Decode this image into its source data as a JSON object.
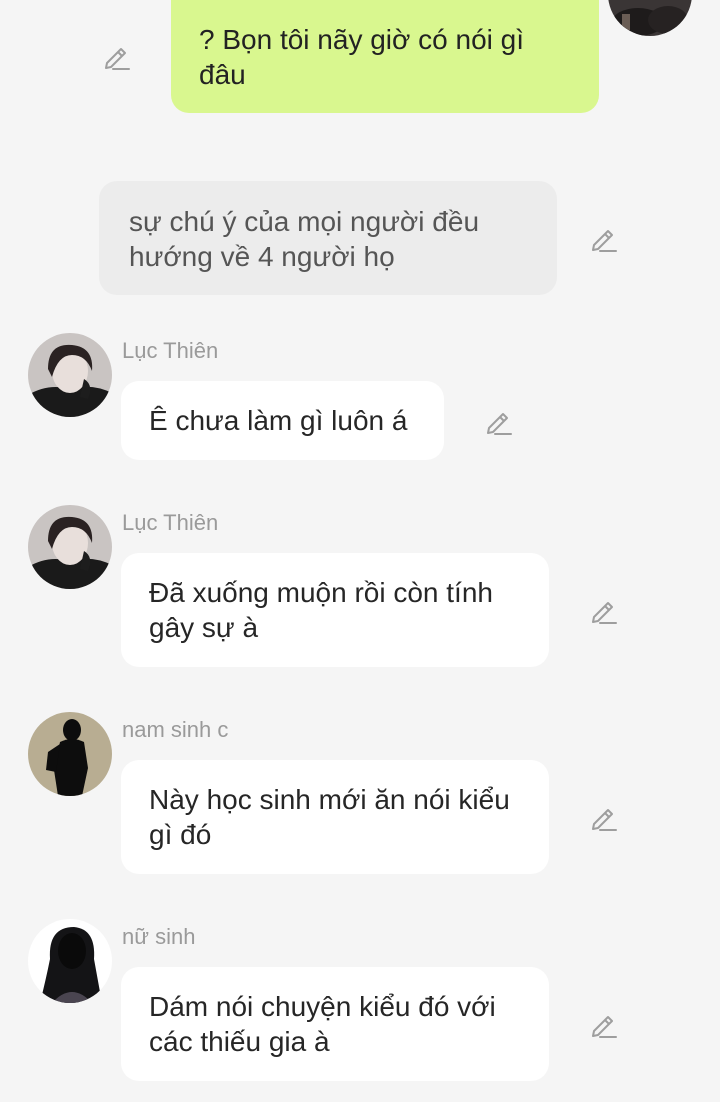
{
  "messages": [
    {
      "id": "m1",
      "type": "self",
      "text": "? Bọn tôi nãy giờ có nói gì đâu"
    },
    {
      "id": "m2",
      "type": "narration",
      "text": "sự chú ý của mọi người đều hướng về 4 người họ"
    },
    {
      "id": "m3",
      "type": "other",
      "sender": "Lục Thiên",
      "avatar_icon": "dark-haired-man-avatar",
      "text": "Ê chưa làm gì luôn á"
    },
    {
      "id": "m4",
      "type": "other",
      "sender": "Lục Thiên",
      "avatar_icon": "dark-haired-man-avatar",
      "text": "Đã xuống muộn rồi còn tính gây sự à"
    },
    {
      "id": "m5",
      "type": "other",
      "sender": "nam sinh c",
      "avatar_icon": "male-silhouette-avatar",
      "text": "Này học sinh mới ăn nói kiểu gì đó"
    },
    {
      "id": "m6",
      "type": "other",
      "sender": "nữ sinh",
      "avatar_icon": "female-silhouette-avatar",
      "text": "Dám nói chuyện kiểu đó với các thiếu gia à"
    }
  ],
  "icons": {
    "edit": "edit-pencil-icon"
  },
  "colors": {
    "background": "#f5f5f5",
    "self_bubble": "#d9f78f",
    "narration_bubble": "#ececec",
    "other_bubble": "#ffffff",
    "sender_name": "#9a9a9a"
  }
}
